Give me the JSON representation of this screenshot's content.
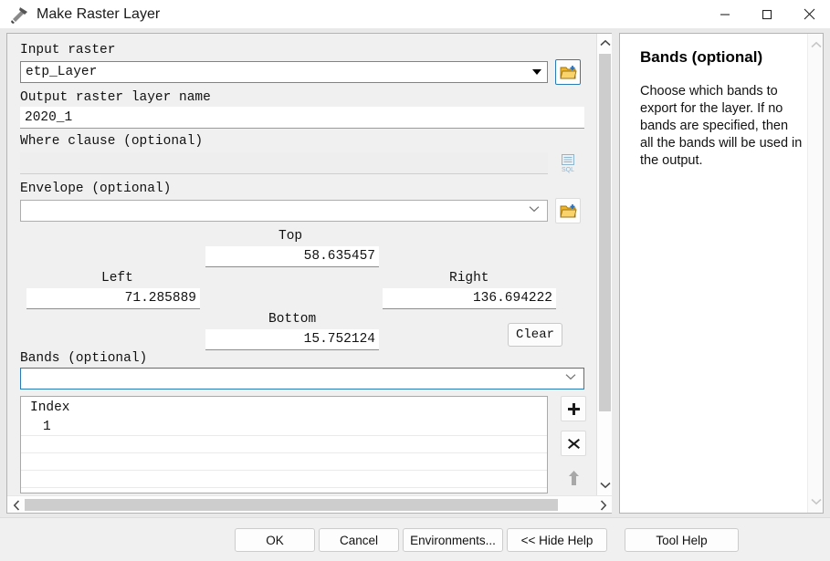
{
  "window": {
    "title": "Make Raster Layer",
    "icon": "hammer-tool-icon",
    "minimize_label": "Minimize",
    "maximize_label": "Maximize",
    "close_label": "Close"
  },
  "form": {
    "input_raster": {
      "label": "Input raster",
      "value": "etp_Layer",
      "browse_icon": "open-folder-add-icon"
    },
    "output_name": {
      "label": "Output raster layer name",
      "value": "2020_1"
    },
    "where_clause": {
      "label": "Where clause (optional)",
      "value": "",
      "placeholder": "",
      "sql_icon": "sql-query-builder-icon"
    },
    "envelope": {
      "label": "Envelope (optional)",
      "value": "",
      "browse_icon": "open-folder-add-icon",
      "top_label": "Top",
      "top_value": "58.635457",
      "left_label": "Left",
      "left_value": "71.285889",
      "right_label": "Right",
      "right_value": "136.694222",
      "bottom_label": "Bottom",
      "bottom_value": "15.752124",
      "clear_label": "Clear"
    },
    "bands": {
      "label": "Bands (optional)",
      "value": "",
      "column_header": "Index",
      "rows": [
        "1",
        "",
        "",
        "",
        ""
      ],
      "add_icon": "plus-icon",
      "remove_icon": "x-icon",
      "move_up_icon": "arrow-up-icon"
    }
  },
  "help": {
    "title": "Bands (optional)",
    "body": "Choose which bands to export for the layer. If no bands are specified, then all the bands will be used in the output."
  },
  "footer": {
    "ok": "OK",
    "cancel": "Cancel",
    "environments": "Environments...",
    "hide_help": "<< Hide Help",
    "tool_help": "Tool Help"
  },
  "colors": {
    "accent": "#2b7cb5",
    "panel": "#f0f0f0",
    "folder": "#f2c14b"
  }
}
